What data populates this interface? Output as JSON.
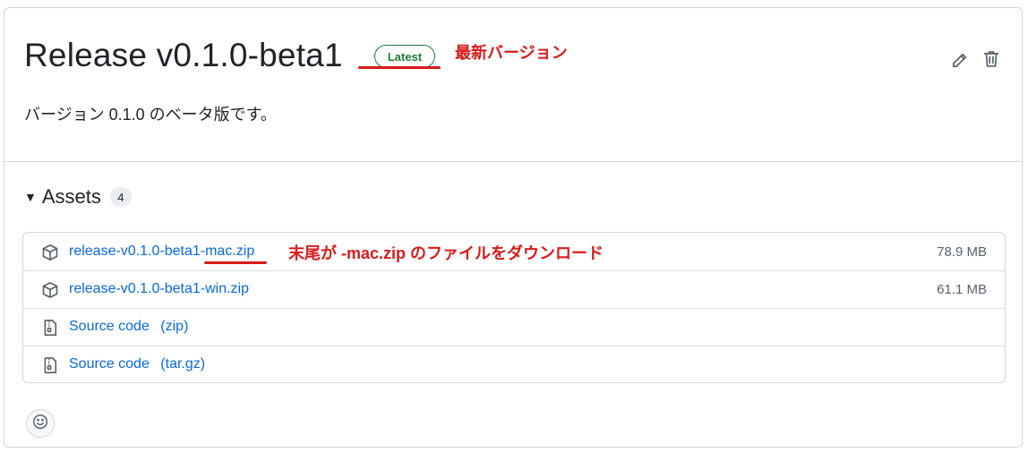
{
  "release": {
    "title": "Release v0.1.0-beta1",
    "badge": "Latest",
    "badge_annotation": "最新バージョン",
    "description": "バージョン 0.1.0 のベータ版です。"
  },
  "assets": {
    "label": "Assets",
    "count": "4",
    "items": [
      {
        "name": "release-v0.1.0-beta1-mac.zip",
        "suffix": "",
        "size": "78.9 MB",
        "icon": "package-icon"
      },
      {
        "name": "release-v0.1.0-beta1-win.zip",
        "suffix": "",
        "size": "61.1 MB",
        "icon": "package-icon"
      },
      {
        "name": "Source code",
        "suffix": "(zip)",
        "size": "",
        "icon": "file-zip-icon"
      },
      {
        "name": "Source code",
        "suffix": "(tar.gz)",
        "size": "",
        "icon": "file-zip-icon"
      }
    ],
    "mac_annotation": "末尾が -mac.zip のファイルをダウンロード"
  },
  "colors": {
    "link": "#0969da",
    "latest_green": "#1a7f37",
    "annotation_red": "#d81b1b"
  }
}
